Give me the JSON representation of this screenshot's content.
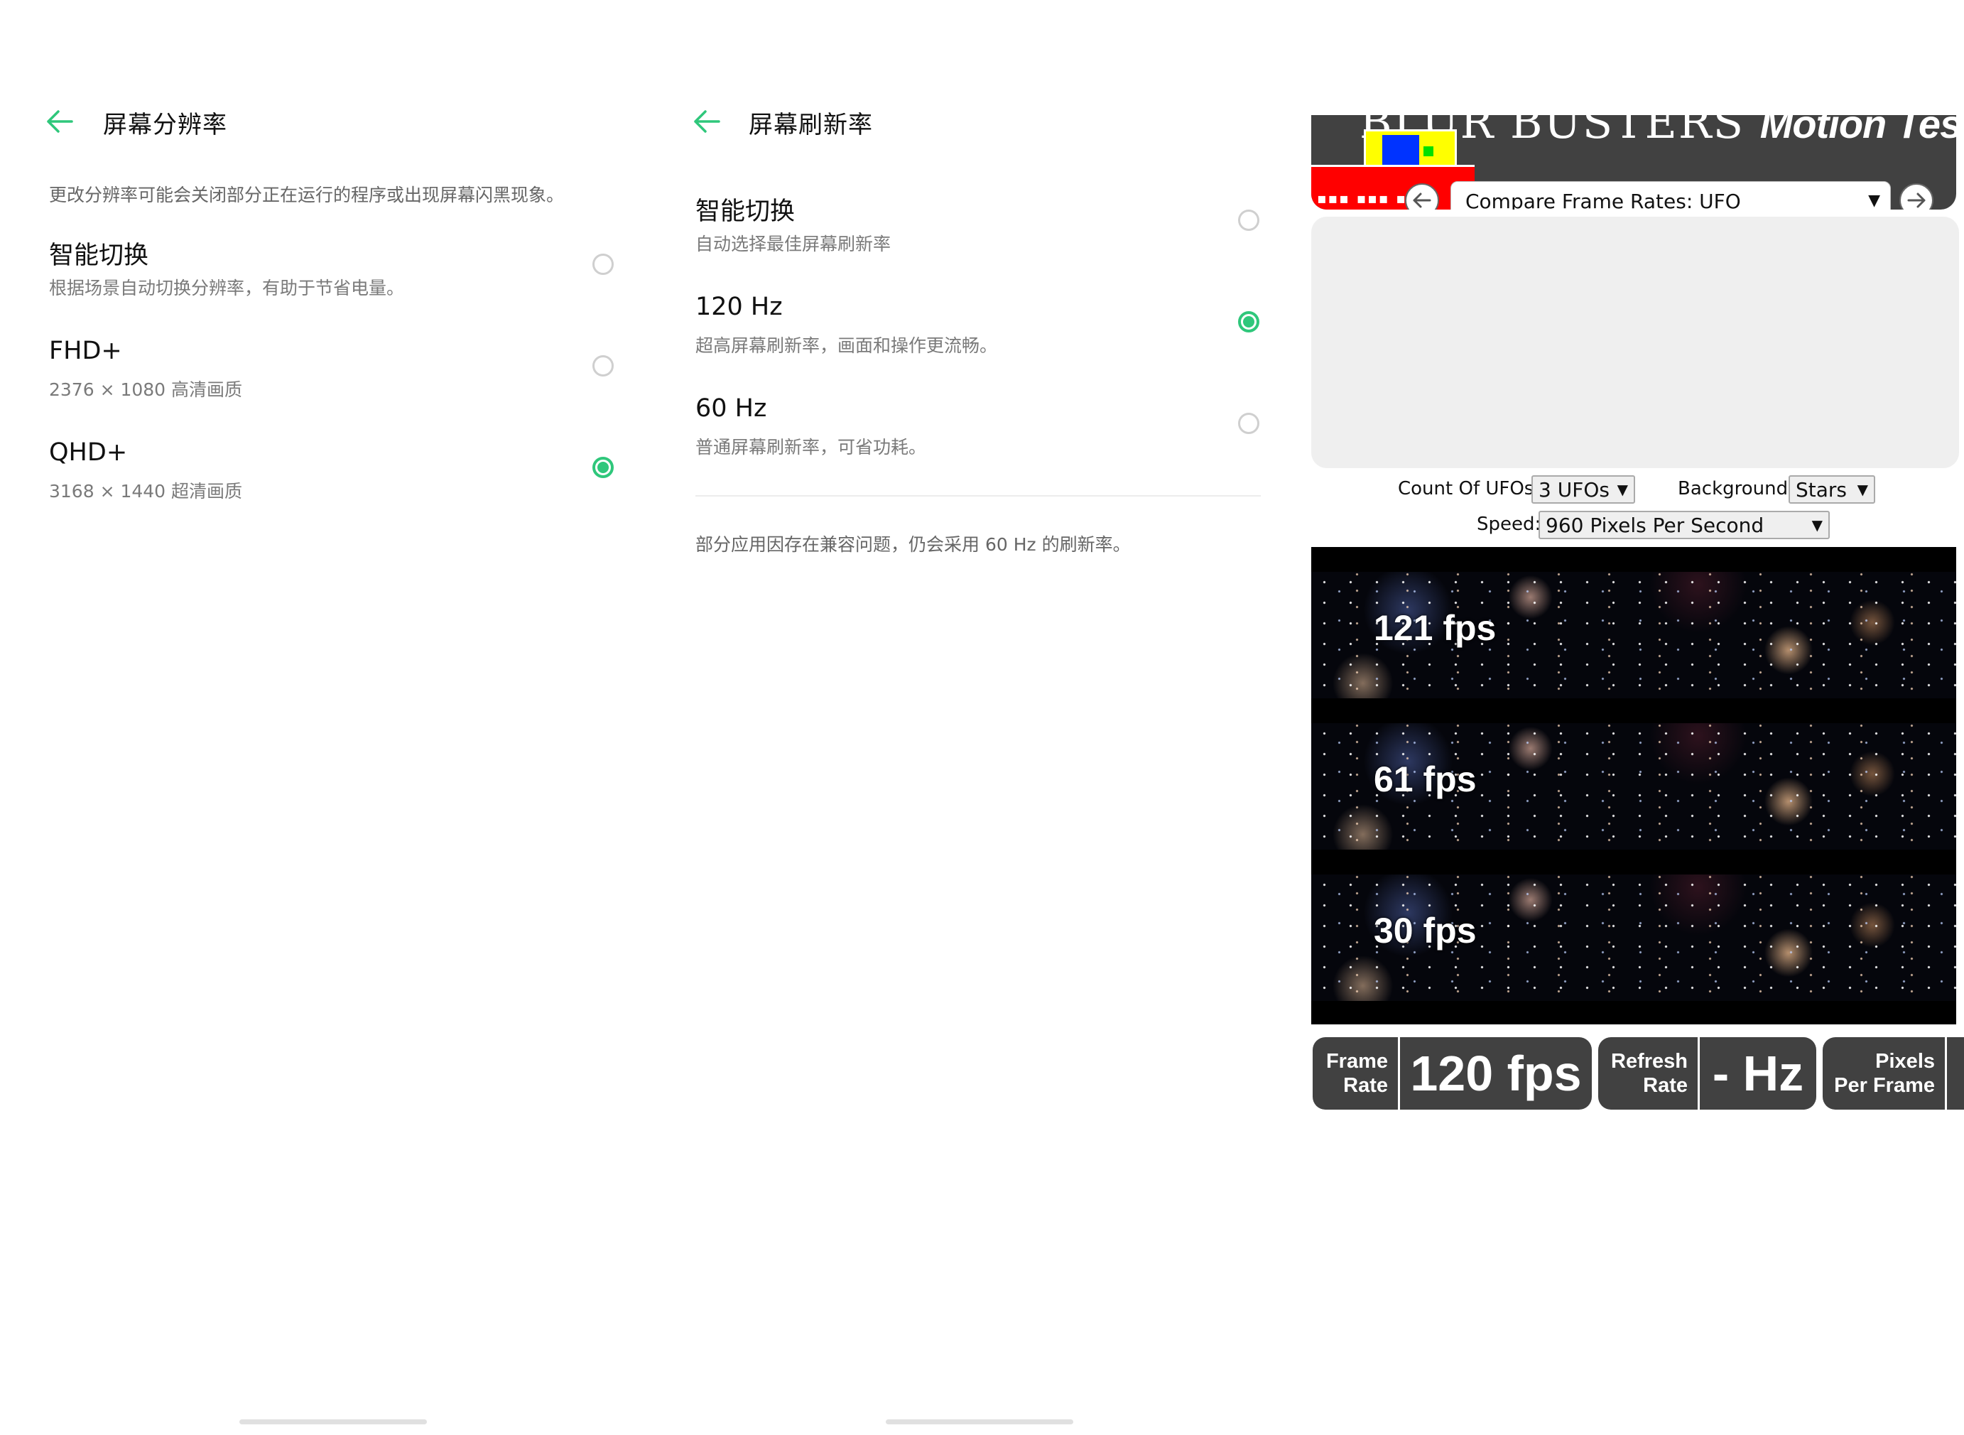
{
  "resolution_panel": {
    "title": "屏幕分辨率",
    "description": "更改分辨率可能会关闭部分正在运行的程序或出现屏幕闪黑现象。",
    "options": [
      {
        "title": "智能切换",
        "subtitle": "根据场景自动切换分辨率，有助于节省电量。",
        "selected": false
      },
      {
        "title": "FHD+",
        "subtitle": "2376 × 1080 高清画质",
        "selected": false
      },
      {
        "title": "QHD+",
        "subtitle": "3168 × 1440 超清画质",
        "selected": true
      }
    ]
  },
  "refresh_panel": {
    "title": "屏幕刷新率",
    "options": [
      {
        "title": "智能切换",
        "subtitle": "自动选择最佳屏幕刷新率",
        "selected": false
      },
      {
        "title": "120 Hz",
        "subtitle": "超高屏幕刷新率，画面和操作更流畅。",
        "selected": true
      },
      {
        "title": "60 Hz",
        "subtitle": "普通屏幕刷新率，可省功耗。",
        "selected": false
      }
    ],
    "footer": "部分应用因存在兼容问题，仍会采用 60 Hz 的刷新率。"
  },
  "motion_test": {
    "logo_text": "BLUR BUSTERS",
    "logo_italic": "Motion Tests",
    "test_select": "Compare Frame Rates: UFO",
    "controls": {
      "count_label": "Count Of UFOs:",
      "count_value": "3 UFOs",
      "background_label": "Background:",
      "background_value": "Stars",
      "speed_label": "Speed:",
      "speed_value": "960 Pixels Per Second"
    },
    "strips": [
      {
        "label": "121 fps"
      },
      {
        "label": "61 fps"
      },
      {
        "label": "30 fps"
      }
    ],
    "stats": {
      "frame_rate_label_1": "Frame",
      "frame_rate_label_2": "Rate",
      "frame_rate_value": "120 fps",
      "refresh_label_1": "Refresh",
      "refresh_label_2": "Rate",
      "refresh_value": "- Hz",
      "ppf_label_1": "Pixels",
      "ppf_label_2": "Per Frame",
      "ppf_value": ""
    }
  },
  "colors": {
    "accent_green": "#2fc77b",
    "panel_dark": "#414141"
  }
}
